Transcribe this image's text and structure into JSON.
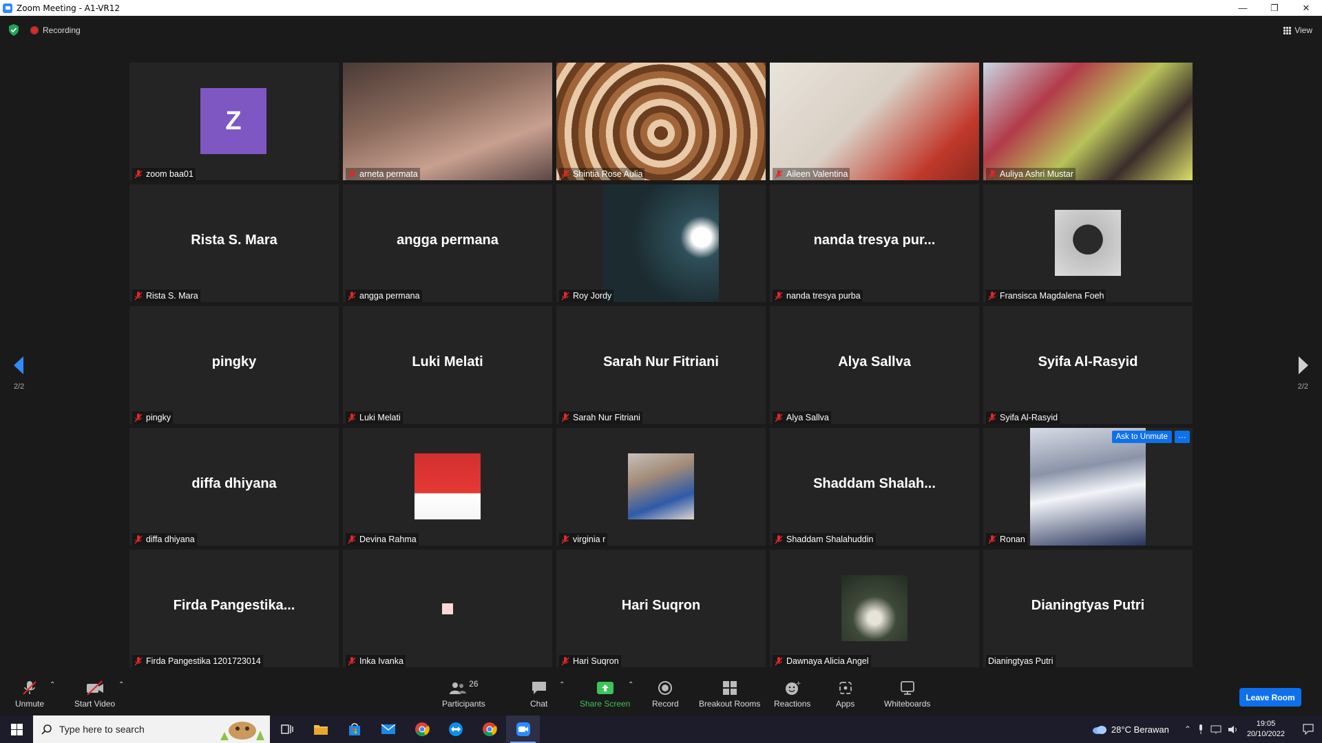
{
  "window": {
    "title": "Zoom Meeting - A1-VR12",
    "controls": [
      "minimize",
      "restore",
      "close"
    ]
  },
  "topbar": {
    "recording_label": "Recording",
    "view_label": "View"
  },
  "paging": {
    "left": "2/2",
    "right": "2/2"
  },
  "participants": [
    {
      "name": "zoom baa01",
      "display": "avatar",
      "avatar_letter": "Z",
      "avatar_color": "#7e57c2",
      "muted": true
    },
    {
      "name": "arneta permata",
      "display": "video",
      "muted": true
    },
    {
      "name": "Shintia Rose Aulia",
      "display": "video",
      "muted": true
    },
    {
      "name": "Aileen Valentina",
      "display": "video",
      "muted": true
    },
    {
      "name": "Auliya Ashri Mustar",
      "display": "video",
      "muted": true
    },
    {
      "name": "Rista S. Mara",
      "display": "name",
      "big_name": "Rista S. Mara",
      "muted": true
    },
    {
      "name": "angga permana",
      "display": "name",
      "big_name": "angga permana",
      "muted": true
    },
    {
      "name": "Roy Jordy",
      "display": "video-mid",
      "muted": true
    },
    {
      "name": "nanda tresya purba",
      "display": "name",
      "big_name": "nanda tresya pur...",
      "muted": true
    },
    {
      "name": "Fransisca Magdalena Foeh",
      "display": "photo",
      "muted": true
    },
    {
      "name": "pingky",
      "display": "name",
      "big_name": "pingky",
      "muted": true
    },
    {
      "name": "Luki Melati",
      "display": "name",
      "big_name": "Luki Melati",
      "muted": true
    },
    {
      "name": "Sarah Nur Fitriani",
      "display": "name",
      "big_name": "Sarah Nur Fitriani",
      "muted": true
    },
    {
      "name": "Alya Sallva",
      "display": "name",
      "big_name": "Alya Sallva",
      "muted": true
    },
    {
      "name": "Syifa Al-Rasyid",
      "display": "name",
      "big_name": "Syifa Al-Rasyid",
      "muted": true
    },
    {
      "name": "diffa dhiyana",
      "display": "name",
      "big_name": "diffa dhiyana",
      "muted": true
    },
    {
      "name": "Devina Rahma",
      "display": "photo",
      "muted": true
    },
    {
      "name": "virginia r",
      "display": "photo",
      "muted": true
    },
    {
      "name": "Shaddam Shalahuddin",
      "display": "name",
      "big_name": "Shaddam  Shalah...",
      "muted": true
    },
    {
      "name": "Ronan",
      "display": "video-mid",
      "muted": true
    },
    {
      "name": "Firda Pangestika 1201723014",
      "display": "name",
      "big_name": "Firda  Pangestika...",
      "muted": true
    },
    {
      "name": "Inka Ivanka",
      "display": "photo",
      "muted": true
    },
    {
      "name": "Hari Suqron",
      "display": "name",
      "big_name": "Hari Suqron",
      "muted": true
    },
    {
      "name": "Dawnaya Alicia Angel",
      "display": "photo",
      "muted": true
    },
    {
      "name": "Dianingtyas Putri",
      "display": "name",
      "big_name": "Dianingtyas Putri",
      "muted": false
    }
  ],
  "hover_tile": {
    "ask_unmute_label": "Ask to Unmute",
    "more_label": "···"
  },
  "toolbar": {
    "unmute": "Unmute",
    "start_video": "Start Video",
    "participants": "Participants",
    "participants_count": "26",
    "chat": "Chat",
    "share_screen": "Share Screen",
    "record": "Record",
    "breakout_rooms": "Breakout Rooms",
    "reactions": "Reactions",
    "apps": "Apps",
    "whiteboards": "Whiteboards",
    "leave": "Leave Room"
  },
  "taskbar": {
    "search_placeholder": "Type here to search",
    "weather": "28°C  Berawan",
    "time": "19:05",
    "date": "20/10/2022"
  },
  "colors": {
    "accent_blue": "#0e71eb",
    "share_green": "#3cc45a",
    "muted_red": "#e02828",
    "tile_bg": "#242424"
  }
}
